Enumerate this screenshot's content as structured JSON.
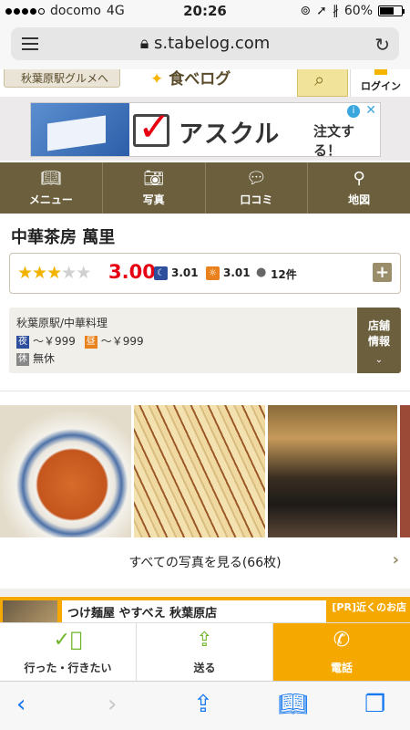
{
  "statusbar": {
    "carrier": "docomo",
    "network": "4G",
    "time": "20:26",
    "battery": "60%",
    "battery_level": 0.6,
    "signal_bars": 4
  },
  "browser": {
    "url": "s.tabelog.com"
  },
  "site": {
    "breadcrumb": "秋葉原駅グルメへ",
    "logo": "食べログ",
    "login": "ログイン"
  },
  "ad": {
    "brand": "アスクル",
    "cta": "注文する！"
  },
  "tabs": [
    {
      "label": "メニュー",
      "icon": "book-icon"
    },
    {
      "label": "写真",
      "icon": "camera-icon"
    },
    {
      "label": "口コミ",
      "icon": "comment-icon"
    },
    {
      "label": "地図",
      "icon": "map-pin-icon"
    }
  ],
  "restaurant": {
    "name": "中華茶房 萬里",
    "rating": 3.0,
    "score": "3.00",
    "night_score": "3.01",
    "day_score": "3.01",
    "reviews": "12件",
    "genre": "秋葉原駅/中華料理",
    "dinner_badge": "夜",
    "dinner_price": "～￥999",
    "lunch_badge": "昼",
    "lunch_price": "～￥999",
    "holiday_badge": "休",
    "holiday": "無休",
    "info_button": "店舗\n情報"
  },
  "photos": {
    "see_all": "すべての写真を見る(66枚)"
  },
  "pr": {
    "name": "つけ麺屋 やすべえ 秋葉原店",
    "label": "[PR]近くのお店"
  },
  "actions": [
    {
      "label": "行った・行きたい",
      "icon": "check-icon"
    },
    {
      "label": "送る",
      "icon": "share-icon"
    },
    {
      "label": "電話",
      "icon": "phone-icon"
    }
  ],
  "colors": {
    "brand_brown": "#6b5f3d",
    "accent_orange": "#f5a800",
    "score_red": "#e60012",
    "star": "#f0b400"
  }
}
